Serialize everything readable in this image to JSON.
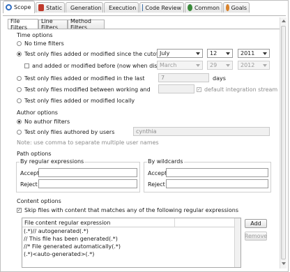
{
  "top_tabs": [
    {
      "label": "Scope",
      "icon": "wrench-icon",
      "color": "#2f6cc0"
    },
    {
      "label": "Static",
      "icon": "static-icon",
      "color": "#c0392b"
    },
    {
      "label": "Generation",
      "icon": "generation-icon",
      "color": "#8a6d3b"
    },
    {
      "label": "Execution",
      "icon": "execution-icon",
      "color": "#5a7a2e"
    },
    {
      "label": "Code Review",
      "icon": "code-review-icon",
      "color": "#3c6fa8"
    },
    {
      "label": "Common",
      "icon": "common-icon",
      "color": "#3a8a3a"
    },
    {
      "label": "Goals",
      "icon": "goals-icon",
      "color": "#c9712b"
    }
  ],
  "sub_tabs": [
    "File Filters",
    "Line Filters",
    "Method Filters"
  ],
  "time_options": {
    "title": "Time options",
    "no_time": "No time filters",
    "since_cutoff": "Test only files added or modified since the cutoff date",
    "cutoff_month": "July",
    "cutoff_day": "12",
    "cutoff_year": "2011",
    "before": "and added or modified before (now when disabled)",
    "before_month": "March",
    "before_day": "29",
    "before_year": "2012",
    "last": "Test only files added or modified in the last",
    "last_value": "7",
    "days": "days",
    "between": "Test only files modified between working and",
    "default_stream": "default integration stream",
    "locally": "Test only files added or modified locally"
  },
  "author_options": {
    "title": "Author options",
    "no_author": "No author filters",
    "by_users": "Test only files authored by users",
    "users_value": "cynthia",
    "note": "Note: use comma to separate multiple user names"
  },
  "path_options": {
    "title": "Path options",
    "regex_title": "By regular expressions",
    "wild_title": "By wildcards",
    "accept": "Accept",
    "reject": "Reject"
  },
  "content_options": {
    "title": "Content options",
    "skip": "Skip files with content that matches any of the following regular expressions",
    "column": "File content regular expression",
    "rows": [
      "(.*)// autogenerated(.*)",
      "// This file has been generated(.*)",
      "//* File generated automatically(.*)",
      "(.*)<auto-generated>(.*)"
    ],
    "add": "Add",
    "remove": "Remove"
  },
  "colors": {
    "border": "#cfcfcf",
    "text": "#1a1a1a",
    "disabled": "#8c8c8c"
  }
}
